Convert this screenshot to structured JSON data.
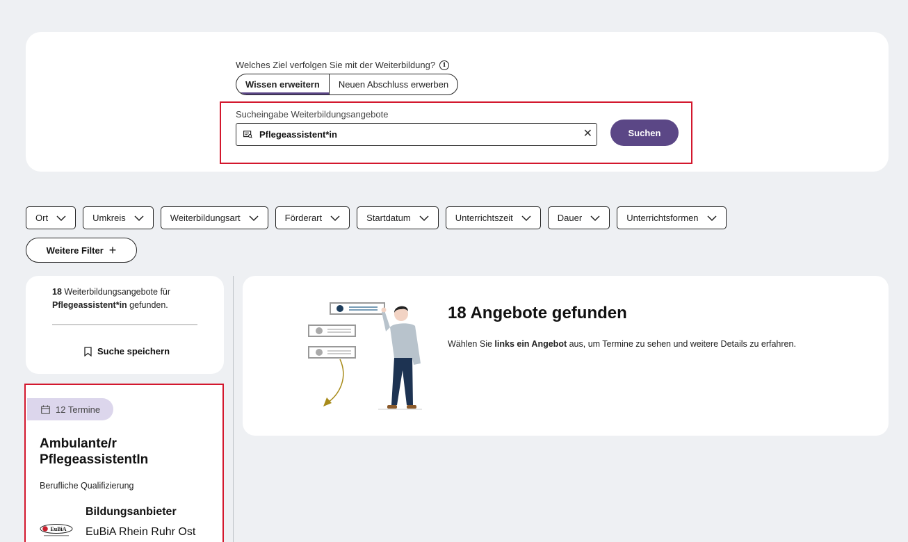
{
  "search": {
    "goal_question": "Welches Ziel verfolgen Sie mit der Weiterbildung?",
    "goal_options": [
      "Wissen erweitern",
      "Neuen Abschluss erwerben"
    ],
    "goal_selected": "Wissen erweitern",
    "input_label": "Sucheingabe Weiterbildungsangebote",
    "input_value": "Pflegeassistent*in",
    "button_label": "Suchen"
  },
  "filters": {
    "items": [
      "Ort",
      "Umkreis",
      "Weiterbildungsart",
      "Förderart",
      "Startdatum",
      "Unterrichtszeit",
      "Dauer",
      "Unterrichtsformen"
    ],
    "more_label": "Weitere Filter"
  },
  "summary": {
    "count": "18",
    "text_after_count": " Weiterbildungsangebote für",
    "query": "Pflegeassistent*in",
    "text_after_query": " gefunden.",
    "save_label": "Suche speichern"
  },
  "offer": {
    "termine": "12 Termine",
    "title": "Ambulante/r PflegeassistentIn",
    "type": "Berufliche Qualifizierung",
    "provider_heading": "Bildungsanbieter",
    "provider_name": "EuBiA Rhein Ruhr Ost",
    "provider_logo_text": "EuBiA"
  },
  "results": {
    "title": "18 Angebote gefunden",
    "desc_prefix": "Wählen Sie ",
    "desc_bold": "links ein Angebot",
    "desc_suffix": " aus, um Termine zu sehen und weitere Details zu erfahren."
  },
  "colors": {
    "accent": "#5b4786",
    "highlight": "#d3172d",
    "badge": "#dcd6ec"
  }
}
